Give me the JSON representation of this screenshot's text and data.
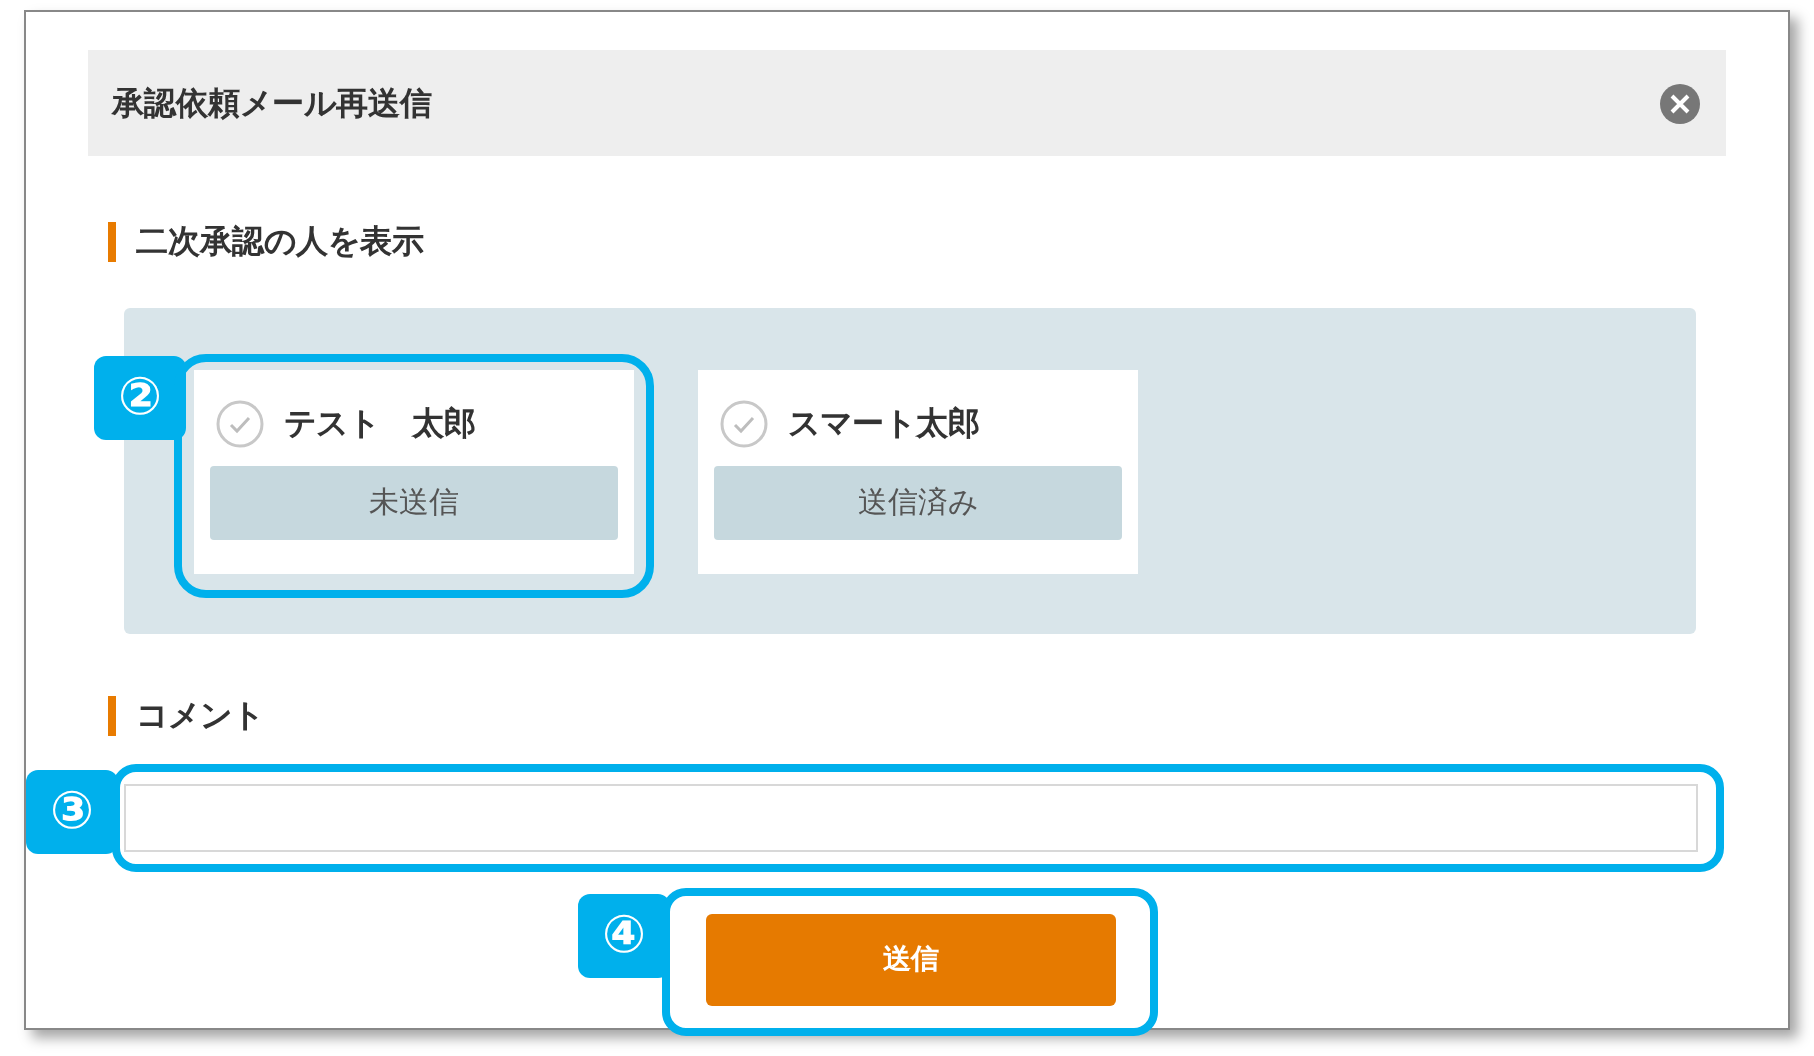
{
  "dialog": {
    "title": "承認依頼メール再送信"
  },
  "approvers_section": {
    "heading": "二次承認の人を表示",
    "people": [
      {
        "name": "テスト　太郎",
        "status": "未送信",
        "callout": "②"
      },
      {
        "name": "スマート太郎",
        "status": "送信済み"
      }
    ]
  },
  "comment_section": {
    "heading": "コメント",
    "callout": "③"
  },
  "send_button": {
    "label": "送信",
    "callout": "④"
  }
}
